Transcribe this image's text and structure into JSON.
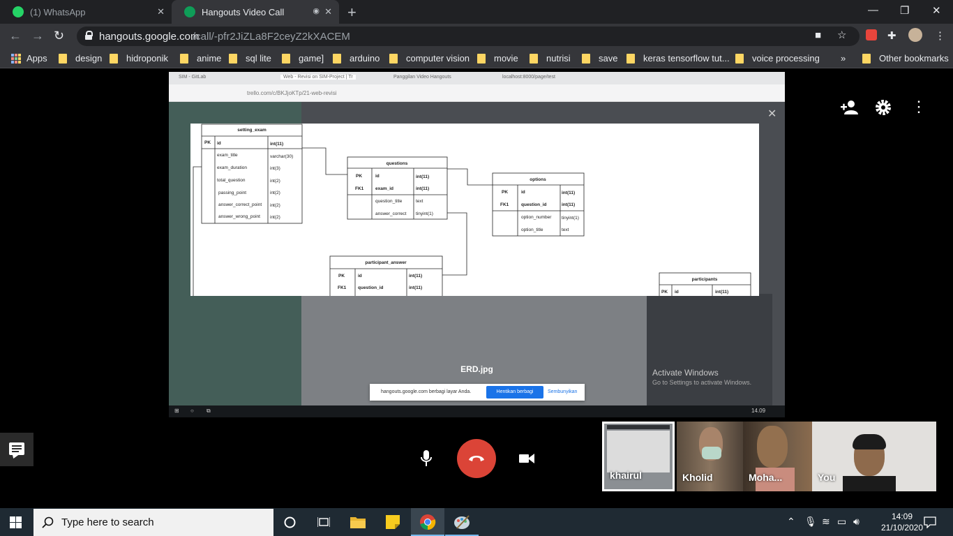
{
  "browser": {
    "tabs": [
      {
        "title": "(1) WhatsApp",
        "favicon_color": "#25d366"
      },
      {
        "title": "Hangouts Video Call",
        "favicon_color": "#0f9d58"
      }
    ],
    "url_host": "hangouts.google.com",
    "url_path": "/call/-pfr2JiZLa8F2ceyZ2kXACEM",
    "bookmarks": [
      "Apps",
      "design",
      "hidroponik",
      "anime",
      "sql lite",
      "game]",
      "arduino",
      "computer vision",
      "movie",
      "nutrisi",
      "save",
      "keras tensorflow tut...",
      "voice processing",
      "»",
      "Other bookmarks"
    ],
    "bookmark_overflow": "»"
  },
  "shared_screen": {
    "inner_tabs": [
      "SIM - GitLab",
      "Web - Revisi on SIM-Project | Tr",
      "Panggilan Video Hangouts",
      "localhost:8000/page/test"
    ],
    "inner_url": "trello.com/c/BKJjoKTp/21-web-revisi",
    "viewer_filename": "ERD.jpg",
    "share_message": "hangouts.google.com berbagi layar Anda.",
    "stop_sharing": "Hentikan berbagi",
    "hide": "Sembunyikan",
    "activate_title": "Activate Windows",
    "activate_sub": "Go to Settings to activate Windows.",
    "inner_clock": "14.09"
  },
  "erd": {
    "setting_exam": {
      "title": "setting_exam",
      "pk": "PK",
      "pk_field": "id",
      "pk_type": "int(11)",
      "fields": [
        [
          "exam_title",
          "varchar(30)"
        ],
        [
          "exam_duration",
          "int(3)"
        ],
        [
          "total_question",
          "int(2)"
        ],
        [
          "passing_point",
          "int(2)"
        ],
        [
          "answer_correct_point",
          "int(2)"
        ],
        [
          "answer_wrong_point",
          "int(2)"
        ]
      ]
    },
    "questions": {
      "title": "questions",
      "keys": [
        "PK",
        "FK1"
      ],
      "key_fields": [
        [
          "id",
          "int(11)"
        ],
        [
          "exam_id",
          "int(11)"
        ]
      ],
      "fields": [
        [
          "question_title",
          "text"
        ],
        [
          "answer_correct",
          "tinyint(1)"
        ]
      ]
    },
    "options": {
      "title": "options",
      "keys": [
        "PK",
        "FK1"
      ],
      "key_fields": [
        [
          "id",
          "int(11)"
        ],
        [
          "question_id",
          "int(11)"
        ]
      ],
      "fields": [
        [
          "option_number",
          "tinyint(1)"
        ],
        [
          "option_title",
          "text"
        ]
      ]
    },
    "participant_answer": {
      "title": "participant_answer",
      "keys": [
        "PK",
        "FK1"
      ],
      "key_fields": [
        [
          "id",
          "int(11)"
        ],
        [
          "question_id",
          "int(11)"
        ]
      ]
    },
    "participants": {
      "title": "participants",
      "keys": [
        "PK"
      ],
      "key_fields": [
        [
          "id",
          "int(11)"
        ]
      ]
    }
  },
  "participants": [
    {
      "name": "khairul",
      "tone": "#8b8f93"
    },
    {
      "name": "Kholid",
      "tone": "#7d6a55"
    },
    {
      "name": "Moha...",
      "tone": "#6b5a49"
    },
    {
      "name": "You",
      "tone": "#d9d7d4"
    }
  ],
  "taskbar": {
    "search_placeholder": "Type here to search",
    "time": "14:09",
    "date": "21/10/2020"
  },
  "colors": {
    "hangup": "#db4437",
    "accent_blue": "#1a73e8",
    "chrome_dark": "#202124",
    "chrome_mid": "#35363a"
  }
}
